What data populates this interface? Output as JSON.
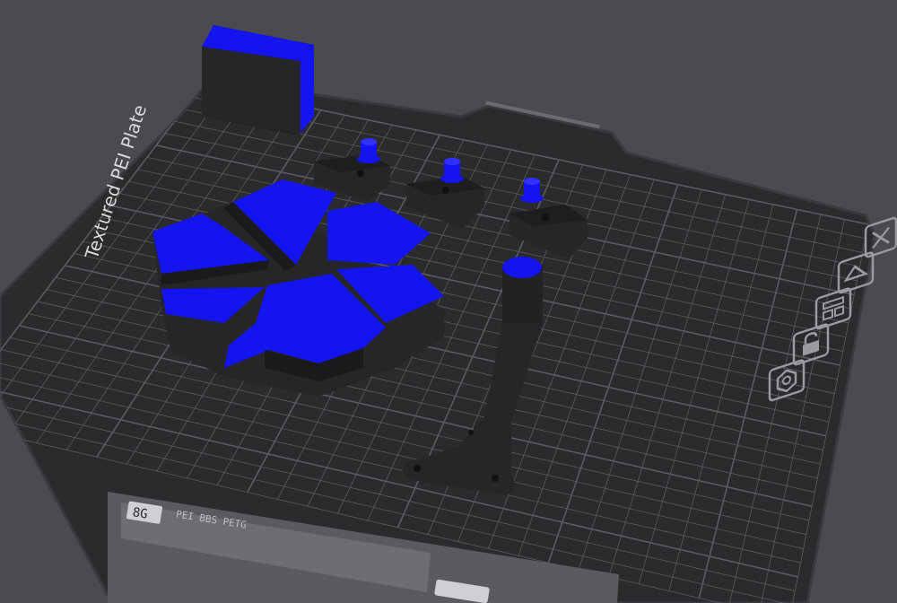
{
  "viewport": {
    "background": "#4a4a4f"
  },
  "plate": {
    "name": "Textured PEI Plate",
    "label_fragment": "PEI BBS PETG",
    "badge_left": "8G",
    "surface_color": "#2b2b2e",
    "grid_color": "#5a5a60",
    "edge_color": "#3a3a3e"
  },
  "model_colors": {
    "body": "#262628",
    "accent": "#1414f0",
    "side_dark": "#1a1a1c"
  },
  "plate_icons": [
    {
      "name": "close-plate-icon"
    },
    {
      "name": "auto-arrange-icon"
    },
    {
      "name": "plate-settings-icon"
    },
    {
      "name": "lock-plate-icon"
    },
    {
      "name": "orient-plate-icon"
    }
  ]
}
